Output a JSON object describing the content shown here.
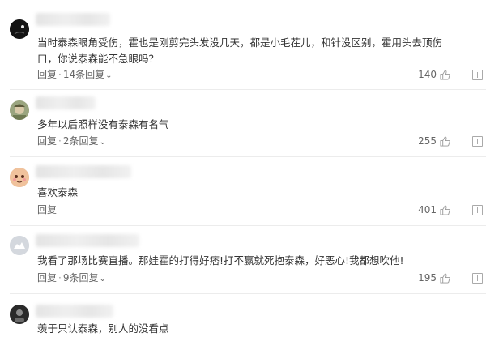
{
  "comments": [
    {
      "text": "当时泰森眼角受伤，霍也是刚剪完头发没几天，都是小毛茬儿，和针没区别，霍用头去顶伤口，你说泰森能不急眼吗？",
      "reply_label": "回复",
      "sep": "·",
      "replies_label": "14条回复",
      "likes": "140",
      "avatar_icon": "black-avatar-icon",
      "avatar_color": "#141414"
    },
    {
      "text": "多年以后照样没有泰森有名气",
      "reply_label": "回复",
      "sep": "·",
      "replies_label": "2条回复",
      "likes": "255",
      "avatar_icon": "character-avatar-icon",
      "avatar_color": "#9aa57f"
    },
    {
      "text": "喜欢泰森",
      "reply_label": "回复",
      "likes": "401",
      "avatar_icon": "cartoon-face-avatar-icon",
      "avatar_color": "#e8b48e"
    },
    {
      "text": "我看了那场比赛直播。那娃霍的打得好痞!打不赢就死抱泰森，好恶心!我都想吹他!",
      "reply_label": "回复",
      "sep": "·",
      "replies_label": "9条回复",
      "likes": "195",
      "avatar_icon": "default-avatar-icon",
      "avatar_color": "#cfd3da"
    },
    {
      "text": "羡于只认泰森，别人的没看点",
      "avatar_icon": "dark-avatar-icon",
      "avatar_color": "#2a2a2a"
    }
  ],
  "colors": {
    "text": "#333333",
    "secondary": "#666666",
    "divider": "#ececec"
  }
}
